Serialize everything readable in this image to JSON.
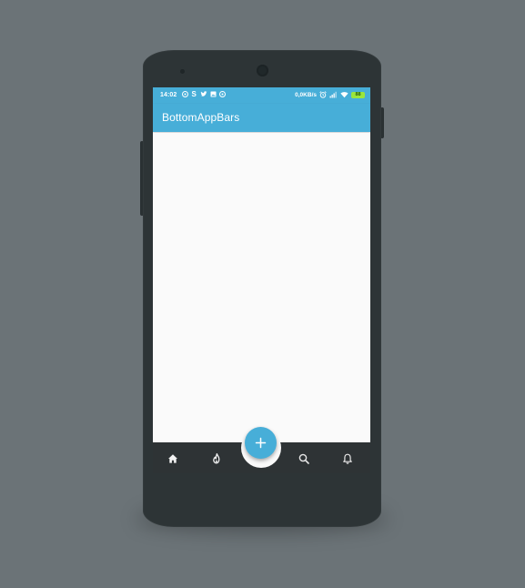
{
  "status_bar": {
    "time": "14:02",
    "left_icons": [
      "notification-icon",
      "skype-icon",
      "twitter-icon",
      "gallery-icon",
      "notification-icon"
    ],
    "net_speed": "0,0KB/s",
    "right_icons": [
      "alarm-icon",
      "signal-icon",
      "wifi-icon",
      "battery-icon"
    ],
    "battery_level": "88"
  },
  "app_bar": {
    "title": "BottomAppBars"
  },
  "fab": {
    "icon": "plus-icon"
  },
  "bottom_nav": {
    "items": [
      {
        "icon": "home-icon"
      },
      {
        "icon": "fire-icon"
      },
      {
        "icon": "search-icon"
      },
      {
        "icon": "bell-icon"
      }
    ]
  },
  "colors": {
    "background": "#6b7377",
    "phone_body": "#2d3436",
    "accent": "#47aed8",
    "bottom_bar": "#2e3335",
    "screen": "#fafafa"
  }
}
